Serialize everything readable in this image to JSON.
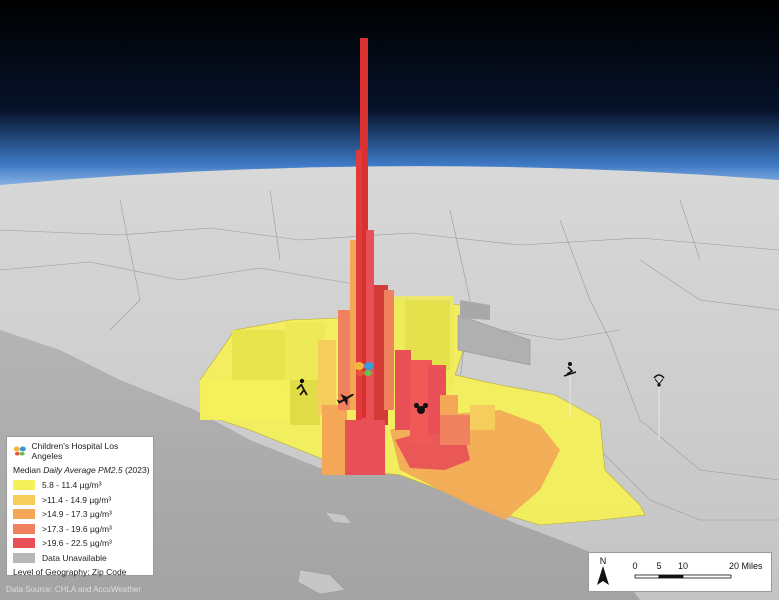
{
  "legend": {
    "hospital_label": "Children's Hospital Los Angeles",
    "title_prefix": "Median ",
    "title_italic": "Daily Average PM2.5",
    "title_suffix": " (2023)",
    "classes": [
      {
        "label": "5.8 - 11.4 µg/m³",
        "color": "#f4f05a"
      },
      {
        "label": ">11.4 - 14.9 µg/m³",
        "color": "#f6cd5c"
      },
      {
        "label": ">14.9 - 17.3 µg/m³",
        "color": "#f3a757"
      },
      {
        "label": ">17.3 - 19.6 µg/m³",
        "color": "#ef815e"
      },
      {
        "label": ">19.6 - 22.5 µg/m³",
        "color": "#e84f56"
      },
      {
        "label": "Data Unavailable",
        "color": "#b7b7b7"
      }
    ],
    "level_label": "Level of Geography: Zip Code"
  },
  "source": "Data Source: CHLA and AccuWeather",
  "scale_bar": {
    "north_label": "N",
    "ticks": [
      "0",
      "5",
      "10",
      "20 Miles"
    ]
  },
  "map": {
    "sky_color": "#000000",
    "horizon_color": "#7fb3e8",
    "land_color": "#c9c9c9",
    "ocean_color": "#a9a9a9",
    "icons": [
      "hospital-butterfly-icon",
      "hiker-icon",
      "airplane-icon",
      "mouse-ears-icon",
      "skier-icon",
      "parachute-icon"
    ]
  }
}
